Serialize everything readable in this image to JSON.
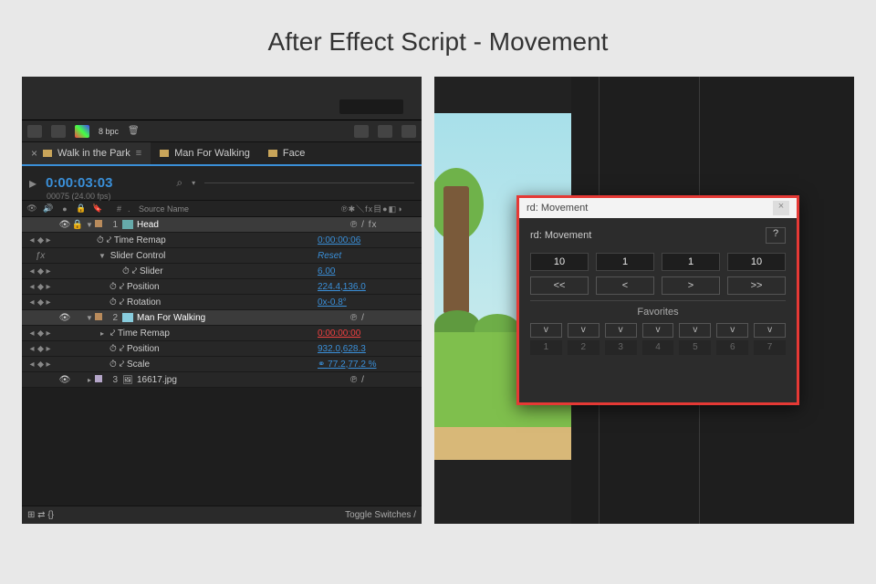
{
  "title": "After Effect Script - Movement",
  "toolbar": {
    "bpc": "8 bpc"
  },
  "tabs": {
    "t1": {
      "label": "Walk in the Park"
    },
    "t2": {
      "label": "Man For Walking"
    },
    "t3": {
      "label": "Face"
    }
  },
  "time": {
    "code": "0:00:03:03",
    "sub": "00075 (24.00 fps)"
  },
  "cols": {
    "num": "#",
    "src": "Source Name"
  },
  "layers": {
    "l1": {
      "num": "1",
      "name": "Head",
      "modes": "℗  /  fx"
    },
    "l1a": {
      "name": "Time Remap",
      "val": "0:00:00:06"
    },
    "l1b": {
      "name": "Slider Control",
      "val": "Reset"
    },
    "l1b1": {
      "name": "Slider",
      "val": "6.00"
    },
    "l1c": {
      "name": "Position",
      "val": "224.4,136.0"
    },
    "l1d": {
      "name": "Rotation",
      "val": "0x-0.8°"
    },
    "l2": {
      "num": "2",
      "name": "Man For Walking",
      "modes": "℗  /"
    },
    "l2a": {
      "name": "Time Remap",
      "val": "0:00:00:00"
    },
    "l2b": {
      "name": "Position",
      "val": "932.0,628.3"
    },
    "l2c": {
      "name": "Scale",
      "val": "77.2,77.2 %",
      "link": "⚭ "
    },
    "l3": {
      "num": "3",
      "name": "16617.jpg",
      "modes": "℗  /"
    }
  },
  "fx": "ƒx",
  "footer": {
    "toggle": "Toggle Switches / "
  },
  "script": {
    "wintitle": "rd: Movement",
    "heading": "rd: Movement",
    "help": "?",
    "inputs": [
      "10",
      "1",
      "1",
      "10"
    ],
    "nav": [
      "<<",
      "<",
      ">",
      ">>"
    ],
    "favlabel": "Favorites",
    "favs": [
      {
        "v": "v",
        "n": "1"
      },
      {
        "v": "v",
        "n": "2"
      },
      {
        "v": "v",
        "n": "3"
      },
      {
        "v": "v",
        "n": "4"
      },
      {
        "v": "v",
        "n": "5"
      },
      {
        "v": "v",
        "n": "6"
      },
      {
        "v": "v",
        "n": "7"
      }
    ]
  }
}
